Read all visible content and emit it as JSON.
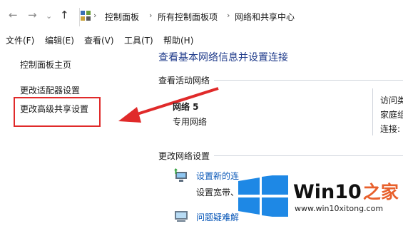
{
  "nav": {
    "back_icon": "back-arrow-icon",
    "forward_icon": "forward-arrow-icon",
    "history_icon": "chevron-down-icon",
    "up_icon": "up-arrow-icon"
  },
  "breadcrumb": [
    "控制面板",
    "所有控制面板项",
    "网络和共享中心"
  ],
  "menu": [
    "文件(F)",
    "编辑(E)",
    "查看(V)",
    "工具(T)",
    "帮助(H)"
  ],
  "sidebar": {
    "home": "控制面板主页",
    "adapter": "更改适配器设置",
    "sharing": "更改高级共享设置"
  },
  "main": {
    "title": "查看基本网络信息并设置连接",
    "active_header": "查看活动网络",
    "network_name": "网络  5",
    "network_type": "专用网络",
    "right_labels": [
      "访问类",
      "家庭组",
      "连接:"
    ],
    "change_header": "更改网络设置",
    "setup_link": "设置新的连",
    "setup_desc": "设置宽带、",
    "trouble_link": "问题疑难解"
  },
  "watermark": {
    "brand": "Win10",
    "suffix": "之家",
    "url": "www.win10xitong.com"
  },
  "colors": {
    "accent_red": "#e02a2a",
    "title_blue": "#1e3a8a",
    "link_blue": "#0a58b8",
    "win_blue": "#1e88e5"
  }
}
